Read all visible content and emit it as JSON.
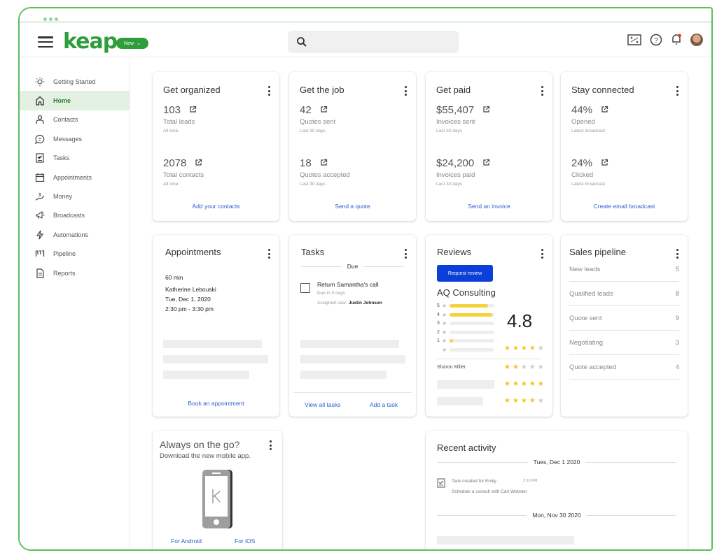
{
  "header": {
    "logo": "keap",
    "new_button": "New",
    "search_placeholder": "",
    "icons": [
      "integrations-icon",
      "help-icon",
      "notification-bell-icon",
      "user-avatar"
    ]
  },
  "sidebar": {
    "items": [
      {
        "label": "Getting Started",
        "icon": "lightbulb-icon",
        "active": false
      },
      {
        "label": "Home",
        "icon": "home-icon",
        "active": true
      },
      {
        "label": "Contacts",
        "icon": "person-icon",
        "active": false
      },
      {
        "label": "Messages",
        "icon": "chat-icon",
        "active": false
      },
      {
        "label": "Tasks",
        "icon": "checklist-icon",
        "active": false
      },
      {
        "label": "Appointments",
        "icon": "calendar-icon",
        "active": false
      },
      {
        "label": "Money",
        "icon": "money-icon",
        "active": false
      },
      {
        "label": "Broadcasts",
        "icon": "megaphone-icon",
        "active": false
      },
      {
        "label": "Automations",
        "icon": "lightning-icon",
        "active": false
      },
      {
        "label": "Pipeline",
        "icon": "pipeline-icon",
        "active": false
      },
      {
        "label": "Reports",
        "icon": "report-icon",
        "active": false
      }
    ]
  },
  "cards": {
    "organized": {
      "title": "Get organized",
      "stats": [
        {
          "value": "103",
          "label": "Total leads",
          "sub": "All time"
        },
        {
          "value": "2078",
          "label": "Total contacts",
          "sub": "All time"
        }
      ],
      "link": "Add your contacts"
    },
    "job": {
      "title": "Get the job",
      "stats": [
        {
          "value": "42",
          "label": "Quotes sent",
          "sub": "Last 30 days"
        },
        {
          "value": "18",
          "label": "Quotes accepted",
          "sub": "Last 30 days"
        }
      ],
      "link": "Send a quote"
    },
    "paid": {
      "title": "Get paid",
      "stats": [
        {
          "value": "$55,407",
          "label": "Invoices sent",
          "sub": "Last 30 days"
        },
        {
          "value": "$24,200",
          "label": "Invoices paid",
          "sub": "Last 30 days"
        }
      ],
      "link": "Send an invoice"
    },
    "connected": {
      "title": "Stay connected",
      "stats": [
        {
          "value": "44%",
          "label": "Opened",
          "sub": "Latest broadcast"
        },
        {
          "value": "24%",
          "label": "Clicked",
          "sub": "Latest broadcast"
        }
      ],
      "link": "Create email broadcast"
    },
    "appointments": {
      "title": "Appointments",
      "duration": "60 min",
      "name": "Katherine Lebouski",
      "date": "Tue, Dec 1, 2020",
      "time": "2:30 pm - 3:30 pm",
      "link": "Book an appointment"
    },
    "tasks": {
      "title": "Tasks",
      "section": "Due",
      "task": {
        "title": "Return Samantha's call",
        "due": "Due in 5 days",
        "assigned_label": "Assigned user:",
        "assigned_user": "Justin Johnson"
      },
      "link_view": "View all tasks",
      "link_add": "Add a task"
    },
    "reviews": {
      "title": "Reviews",
      "button": "Request review",
      "business": "AQ Consulting",
      "rating": "4.8",
      "overall_stars": 4,
      "distribution": [
        {
          "stars": "5",
          "fraction": 0.85
        },
        {
          "stars": "4",
          "fraction": 0.95
        },
        {
          "stars": "3",
          "fraction": 0
        },
        {
          "stars": "2",
          "fraction": 0
        },
        {
          "stars": "1",
          "fraction": 0.08
        },
        {
          "stars": "",
          "fraction": 0
        }
      ],
      "reviews": [
        {
          "name": "Sharon Miller",
          "stars": 2
        },
        {
          "name": "",
          "stars": 5
        },
        {
          "name": "",
          "stars": 4
        }
      ]
    },
    "pipeline": {
      "title": "Sales pipeline",
      "stages": [
        {
          "label": "New leads",
          "count": "5"
        },
        {
          "label": "Qualified leads",
          "count": "8"
        },
        {
          "label": "Quote sent",
          "count": "9"
        },
        {
          "label": "Negotiating",
          "count": "3"
        },
        {
          "label": "Quote accepted",
          "count": "4"
        }
      ]
    },
    "mobile": {
      "title": "Always on the go?",
      "subtitle": "Download the new mobile app.",
      "android": "For Android",
      "ios": "For iOS"
    },
    "activity": {
      "title": "Recent activity",
      "groups": [
        {
          "date": "Tues, Dec 1 2020",
          "items": [
            {
              "title": "Task created for Emily",
              "time": "3:10 PM",
              "detail": "Schedule a consult with Carl Webster"
            }
          ]
        },
        {
          "date": "Mon, Nov 30 2020",
          "items": []
        }
      ]
    }
  },
  "colors": {
    "brand": "#2e9e3a",
    "link": "#2f5fd0",
    "primary_button": "#0b3fd9",
    "star": "#f5c518"
  }
}
